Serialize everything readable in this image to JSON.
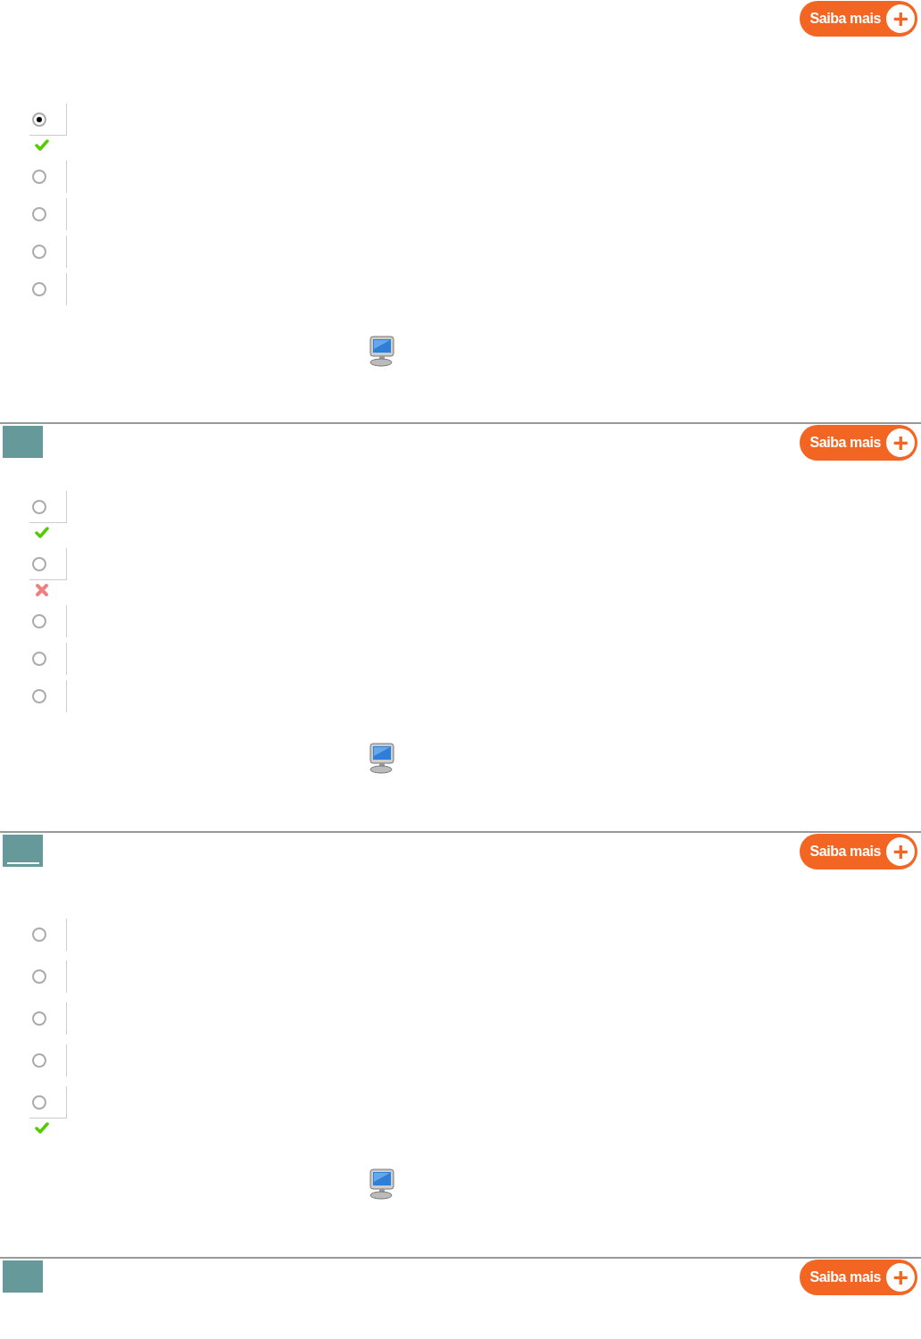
{
  "sections": [
    {
      "kind": "open",
      "button": {
        "label": "Saiba mais",
        "icon": "+"
      },
      "computer_icon": true,
      "options": [
        {
          "selected": true,
          "kind": "correct"
        },
        {
          "selected": false,
          "kind": "plain"
        },
        {
          "selected": false,
          "kind": "plain"
        },
        {
          "selected": false,
          "kind": "plain"
        },
        {
          "selected": false,
          "kind": "plain"
        }
      ]
    },
    {
      "kind": "plain",
      "button": {
        "label": "Saiba mais",
        "icon": "+"
      },
      "computer_icon": true,
      "options": [
        {
          "selected": false,
          "kind": "correct"
        },
        {
          "selected": false,
          "kind": "wrong"
        },
        {
          "selected": false,
          "kind": "plain"
        },
        {
          "selected": false,
          "kind": "plain"
        },
        {
          "selected": false,
          "kind": "plain"
        }
      ]
    },
    {
      "kind": "underlined",
      "button": {
        "label": "Saiba mais",
        "icon": "+"
      },
      "computer_icon": true,
      "options": [
        {
          "selected": false,
          "kind": "plain"
        },
        {
          "selected": false,
          "kind": "plain"
        },
        {
          "selected": false,
          "kind": "plain"
        },
        {
          "selected": false,
          "kind": "plain"
        },
        {
          "selected": false,
          "kind": "correct"
        }
      ]
    },
    {
      "kind": "plain",
      "button": {
        "label": "Saiba mais",
        "icon": "+"
      }
    }
  ]
}
